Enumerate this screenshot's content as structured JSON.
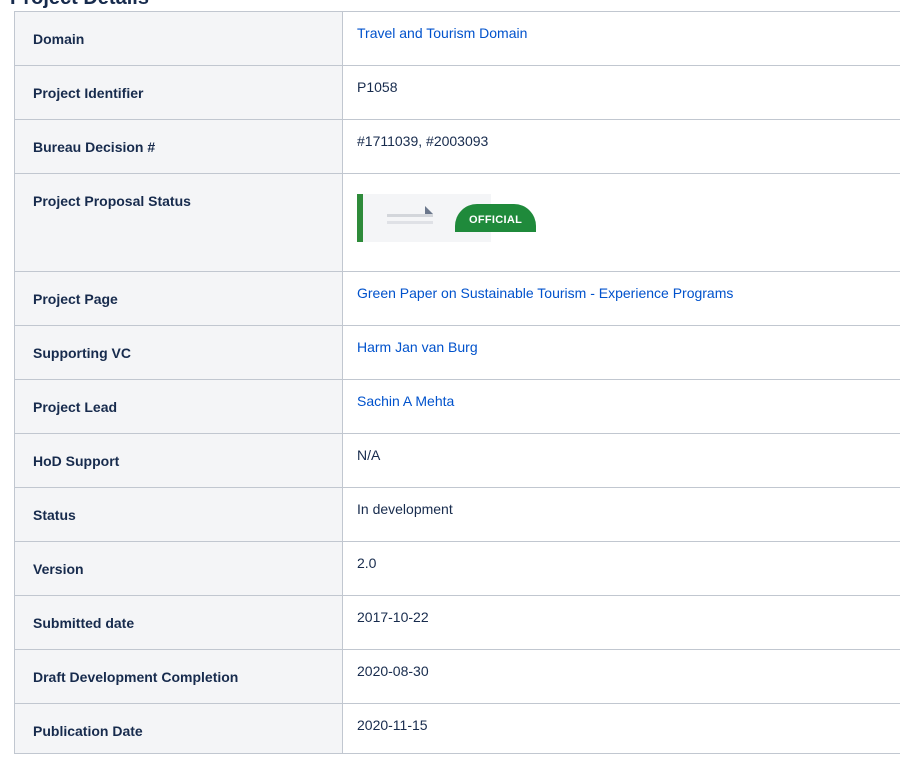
{
  "page": {
    "title": "Project Details"
  },
  "rows": [
    {
      "label": "Domain",
      "value": "Travel and Tourism Domain",
      "link": true
    },
    {
      "label": "Project Identifier",
      "value": "P1058",
      "link": false
    },
    {
      "label": "Bureau Decision #",
      "value": "#1711039, #2003093",
      "link": false
    },
    {
      "label": "Project Proposal Status",
      "value": "",
      "link": false
    },
    {
      "label": "Project Page",
      "value": "Green Paper on Sustainable Tourism - Experience Programs",
      "link": true
    },
    {
      "label": "Supporting VC",
      "value": "Harm Jan van Burg",
      "link": true
    },
    {
      "label": "Project Lead",
      "value": "Sachin A Mehta",
      "link": true
    },
    {
      "label": "HoD Support",
      "value": "N/A",
      "link": false
    },
    {
      "label": "Status",
      "value": "In development",
      "link": false
    },
    {
      "label": "Version",
      "value": "2.0",
      "link": false
    },
    {
      "label": "Submitted date",
      "value": "2017-10-22",
      "link": false
    },
    {
      "label": "Draft Development Completion",
      "value": "2020-08-30",
      "link": false
    },
    {
      "label": "Publication Date",
      "value": "2020-11-15",
      "link": false
    }
  ],
  "proposal_status": {
    "tag_label": "OFFICIAL",
    "icon": "document-icon",
    "accent_color": "#2e8b3a",
    "tag_color": "#1f8a3b"
  },
  "colors": {
    "link": "#0052cc",
    "key_background": "#f4f5f7",
    "border": "#c1c7d0"
  }
}
